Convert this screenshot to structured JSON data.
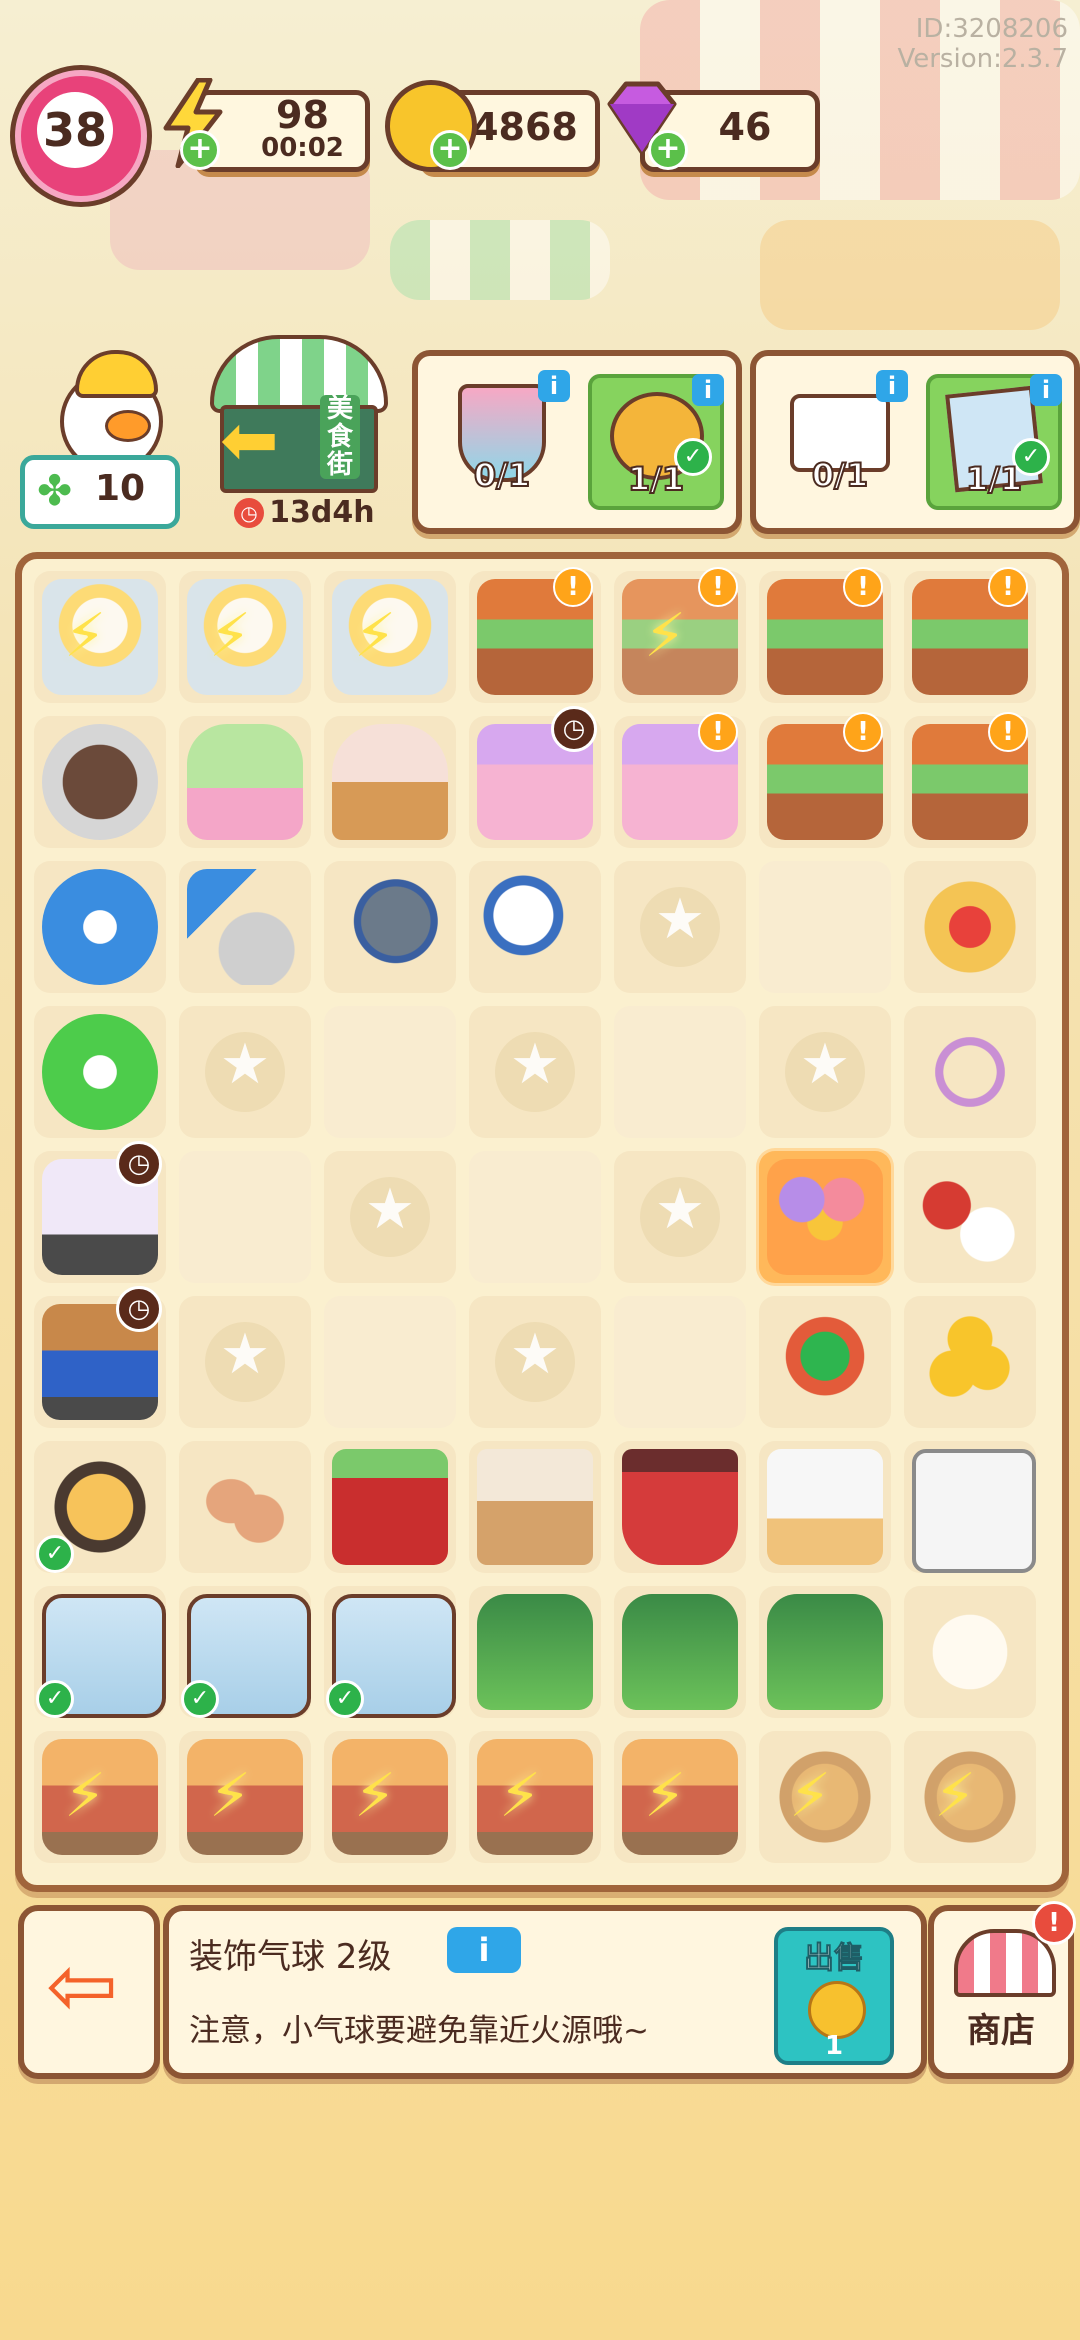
{
  "meta": {
    "id": "ID:3208206",
    "version": "Version:2.3.7"
  },
  "level": "38",
  "energy": {
    "value": "98",
    "timer": "00:02"
  },
  "coins": "4868",
  "gems": "46",
  "clover": "10",
  "event": {
    "name": "美食街",
    "timer": "13d4h"
  },
  "orders": [
    {
      "items": [
        {
          "icon": "strawberry-sundae-icon",
          "count": "0/1"
        },
        {
          "icon": "lion-plush-icon",
          "count": "1/1",
          "done": true
        }
      ]
    },
    {
      "items": [
        {
          "icon": "takeout-box-icon",
          "count": "0/1"
        },
        {
          "icon": "duck-poster-icon",
          "count": "1/1",
          "done": true
        }
      ]
    }
  ],
  "board": {
    "rows": [
      [
        "duck-megaphone-icon",
        "duck-megaphone-icon",
        "duck-megaphone-icon",
        "food-cart-icon",
        "food-cart-icon",
        "food-cart-icon",
        "food-cart-icon"
      ],
      [
        "bubble-tea-icon",
        "matcha-icecream-icon",
        "icecream-cone-icon",
        "icecream-cart-icon",
        "icecream-cart-icon",
        "food-cart-icon",
        "food-cart-icon"
      ],
      [
        "blue-scissors-icon",
        "ice-cream-scoop-icon",
        "frying-pan-icon",
        "megaphone-icon",
        "",
        "",
        "sandwich-icon"
      ],
      [
        "green-scissors-icon",
        "",
        "",
        "",
        "",
        "",
        "string-lights-icon"
      ],
      [
        "food-truck-icon",
        "",
        "",
        "",
        "",
        "balloons-icon",
        "key-icon"
      ],
      [
        "delivery-truck-icon",
        "",
        "",
        "",
        "",
        "open-sign-icon",
        "coin-stack-icon"
      ],
      [
        "lion-plush-icon",
        "eggs-icon",
        "gift-box-icon",
        "cardboard-boxes-icon",
        "red-bucket-icon",
        "takeout-box-icon",
        "empty-takeout-box-icon"
      ],
      [
        "duck-poster-icon",
        "duck-poster-icon",
        "duck-poster-icon",
        "gas-cylinder-icon",
        "gas-cylinder-icon",
        "gas-cylinder-icon",
        "steamed-bun-icon"
      ],
      [
        "bbq-grill-icon",
        "bbq-grill-icon",
        "bbq-grill-icon",
        "bbq-grill-icon",
        "bbq-grill-icon",
        "bread-basket-icon",
        "bread-basket-icon"
      ]
    ]
  },
  "selected_item": {
    "name": "装饰气球 2级",
    "description": "注意，小气球要避免靠近火源哦~",
    "info_label": "i",
    "sell_label": "出售",
    "sell_price": "1"
  },
  "shop_label": "商店",
  "colors": {
    "accent": "#8c5534",
    "green": "#5bc04a",
    "teal": "#2dc3c2",
    "pink": "#e8427a"
  }
}
